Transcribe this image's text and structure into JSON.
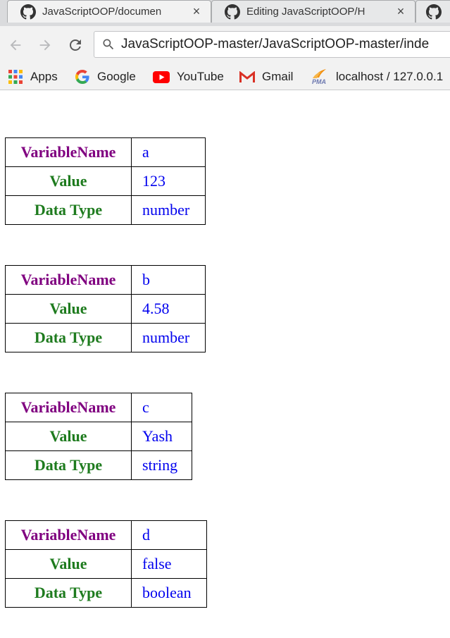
{
  "tabs": [
    {
      "title": "JavaScriptOOP/documen",
      "icon": "github-icon",
      "close": "×"
    },
    {
      "title": "Editing JavaScriptOOP/H",
      "icon": "github-icon",
      "close": "×"
    },
    {
      "title": "",
      "icon": "github-icon"
    }
  ],
  "toolbar": {
    "url": "JavaScriptOOP-master/JavaScriptOOP-master/inde"
  },
  "bookmarks": [
    {
      "label": "Apps",
      "icon": "apps-grid-icon"
    },
    {
      "label": "Google",
      "icon": "google-icon"
    },
    {
      "label": "YouTube",
      "icon": "youtube-icon"
    },
    {
      "label": "Gmail",
      "icon": "gmail-icon"
    },
    {
      "label": "localhost / 127.0.0.1",
      "icon": "phpmyadmin-icon"
    }
  ],
  "colors": {
    "variable_name_label": "#800080",
    "row_label": "#1e7b1e",
    "value_text": "#0000ee"
  },
  "tables": [
    {
      "rows": [
        {
          "label": "VariableName",
          "value": "a"
        },
        {
          "label": "Value",
          "value": "123"
        },
        {
          "label": "Data Type",
          "value": "number"
        }
      ]
    },
    {
      "rows": [
        {
          "label": "VariableName",
          "value": "b"
        },
        {
          "label": "Value",
          "value": "4.58"
        },
        {
          "label": "Data Type",
          "value": "number"
        }
      ]
    },
    {
      "rows": [
        {
          "label": "VariableName",
          "value": "c"
        },
        {
          "label": "Value",
          "value": "Yash"
        },
        {
          "label": "Data Type",
          "value": "string"
        }
      ]
    },
    {
      "rows": [
        {
          "label": "VariableName",
          "value": "d"
        },
        {
          "label": "Value",
          "value": "false"
        },
        {
          "label": "Data Type",
          "value": "boolean"
        }
      ]
    }
  ]
}
